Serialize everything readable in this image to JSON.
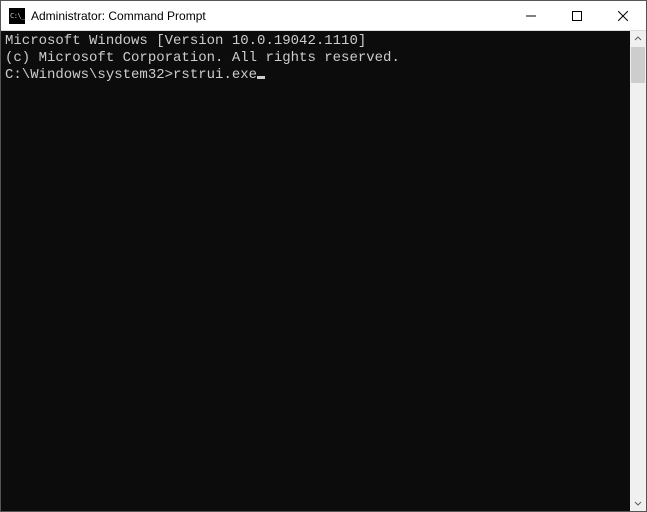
{
  "window": {
    "title": "Administrator: Command Prompt"
  },
  "terminal": {
    "line1": "Microsoft Windows [Version 10.0.19042.1110]",
    "line2": "(c) Microsoft Corporation. All rights reserved.",
    "prompt": "C:\\Windows\\system32>",
    "command": "rstrui.exe"
  }
}
